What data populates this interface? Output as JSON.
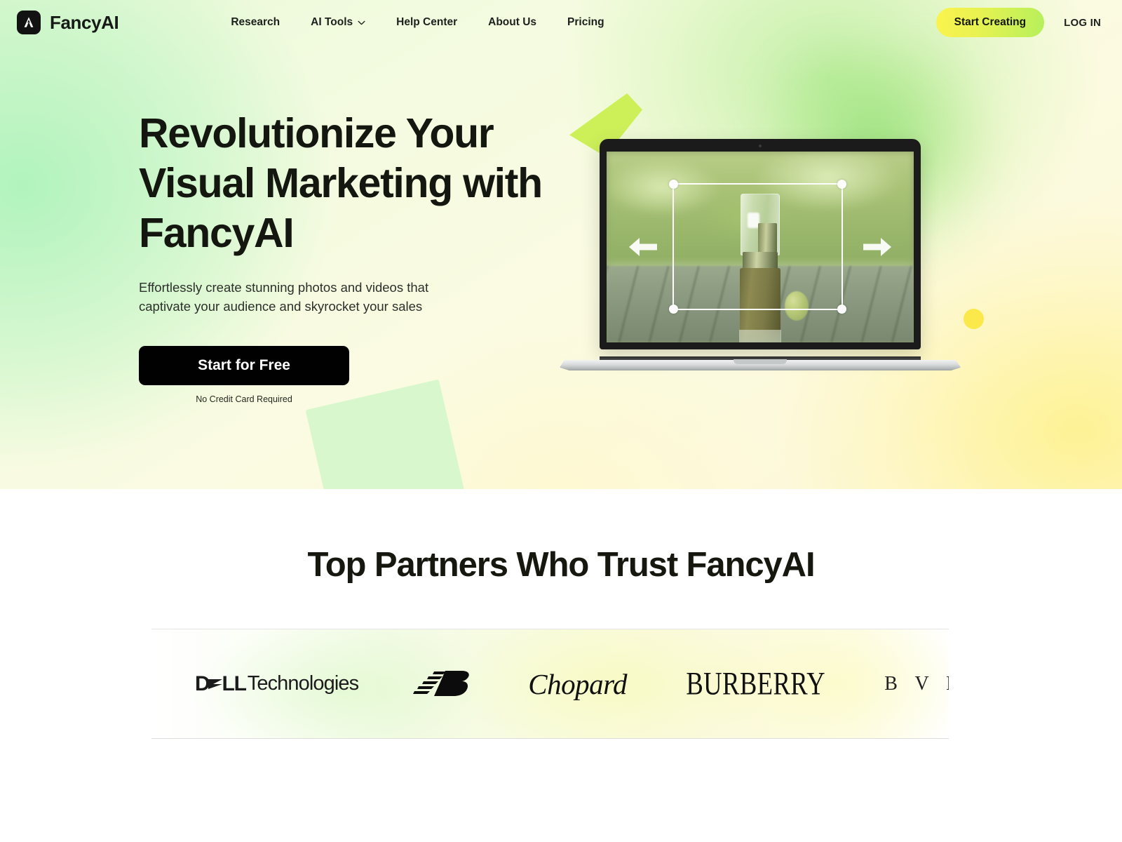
{
  "brand": {
    "name": "FancyAI",
    "logo_icon": "fancyai-chevron-logo",
    "logo_bg": "#121212"
  },
  "nav": {
    "links": [
      {
        "label": "Research",
        "has_chevron": false
      },
      {
        "label": "AI Tools",
        "has_chevron": true,
        "chevron_icon": "chevron-down-icon"
      },
      {
        "label": "Help Center",
        "has_chevron": false
      },
      {
        "label": "About Us",
        "has_chevron": false
      },
      {
        "label": "Pricing",
        "has_chevron": false
      }
    ],
    "cta_label": "Start Creating",
    "cta_gradient": "#fbf34e,#b6f05c",
    "login_label": "LOG IN"
  },
  "hero": {
    "title": "Revolutionize Your Visual Marketing with FancyAI",
    "subtitle": "Effortlessly create stunning photos and videos that captivate your audience and skyrocket your sales",
    "cta_label": "Start for Free",
    "cta_bg": "#010101",
    "note": "No Credit Card Required",
    "background_colors": [
      "#eaf9d8",
      "#f2fbdf",
      "#fbfbe2",
      "#fdf6d6"
    ],
    "decorations": [
      {
        "name": "lime-quadrilateral",
        "color": "#cdf059"
      },
      {
        "name": "green-rotated-square",
        "color": "#d8f7cd"
      },
      {
        "name": "yellow-dot",
        "color": "#fbe94c"
      },
      {
        "name": "green-blur-blob",
        "color": "#78d75a"
      }
    ]
  },
  "mockup": {
    "device": "laptop",
    "screen_content": "product photo of a cosmetic pump bottle on a wooden table with blurred green garden background",
    "overlay": {
      "selection_frame": true,
      "handles": 4,
      "handle_color": "#ffffff",
      "arrow_left_icon": "arrow-left-icon",
      "arrow_right_icon": "arrow-right-icon"
    }
  },
  "partners": {
    "title": "Top Partners Who Trust FancyAI",
    "logos": [
      {
        "name": "dell-technologies",
        "text_bold": "D",
        "text_bold2": "LL",
        "text_regular": "Technologies"
      },
      {
        "name": "new-balance",
        "text": "NB"
      },
      {
        "name": "chopard",
        "text": "Chopard"
      },
      {
        "name": "burberry",
        "text": "BURBERRY"
      },
      {
        "name": "bvlgari",
        "text": "B V L G A R I"
      }
    ]
  }
}
